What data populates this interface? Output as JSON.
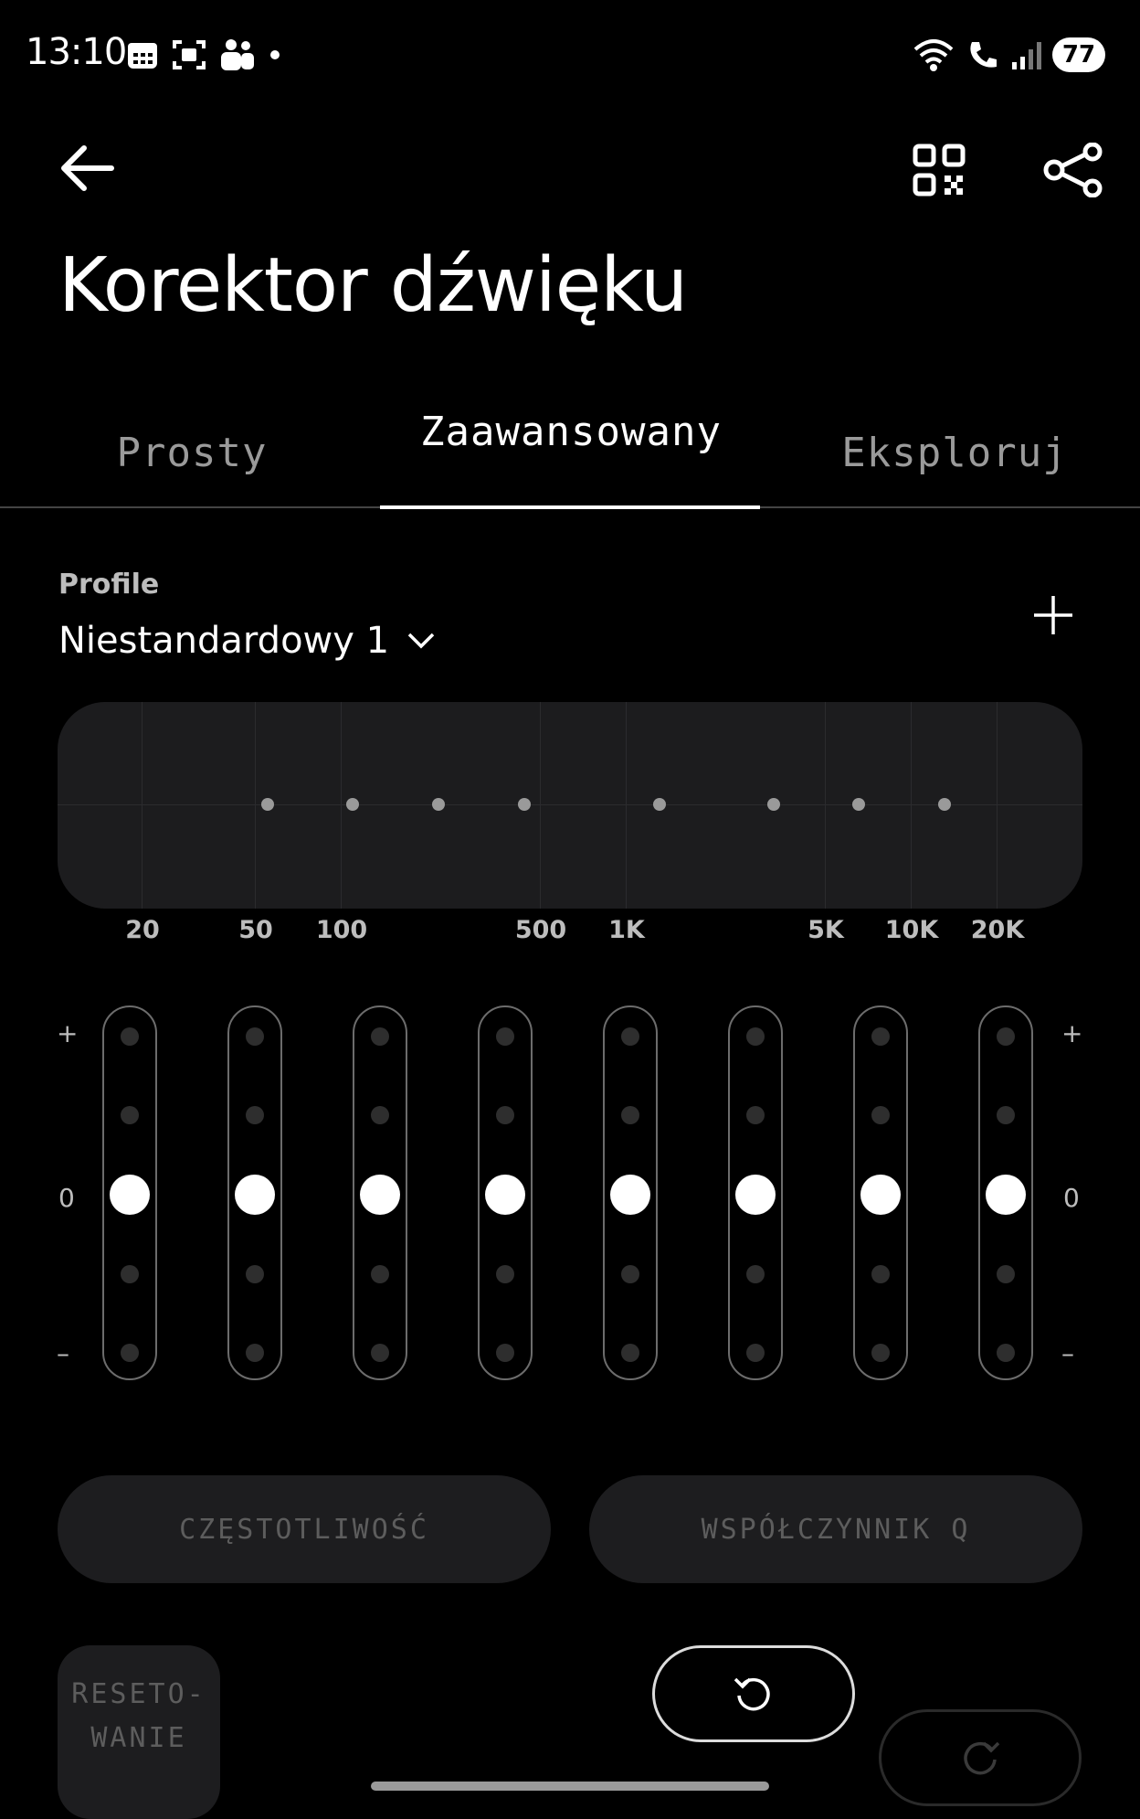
{
  "status_bar": {
    "time": "13:10",
    "battery": "77",
    "icons": [
      "calendar-icon",
      "screenshot-icon",
      "teams-icon",
      "dot-icon",
      "wifi-icon",
      "wifi-call-icon",
      "signal-icon"
    ]
  },
  "header": {
    "title": "Korektor dźwięku",
    "icons": [
      "back-arrow-icon",
      "qr-code-icon",
      "share-icon"
    ]
  },
  "tabs": [
    {
      "label": "Prosty",
      "active": false
    },
    {
      "label": "Zaawansowany",
      "active": true
    },
    {
      "label": "Eksploruj",
      "active": false
    }
  ],
  "profile": {
    "label": "Profile",
    "value": "Niestandardowy 1"
  },
  "graph": {
    "frequency_labels": [
      "20",
      "50",
      "100",
      "500",
      "1K",
      "5K",
      "10K",
      "20K"
    ]
  },
  "sliders": {
    "plus_label": "+",
    "zero_label": "0",
    "minus_label": "–",
    "bands": [
      {
        "level": 0
      },
      {
        "level": 0
      },
      {
        "level": 0
      },
      {
        "level": 0
      },
      {
        "level": 0
      },
      {
        "level": 0
      },
      {
        "level": 0
      },
      {
        "level": 0
      }
    ]
  },
  "buttons": {
    "frequency": "CZĘSTOTLIWOŚĆ",
    "q_factor": "WSPÓŁCZYNNIK Q",
    "reset_line1": "RESETO-",
    "reset_line2": "WANIE"
  },
  "colors": {
    "background": "#000000",
    "panel": "#1c1c1e",
    "accent": "#ffffff"
  }
}
